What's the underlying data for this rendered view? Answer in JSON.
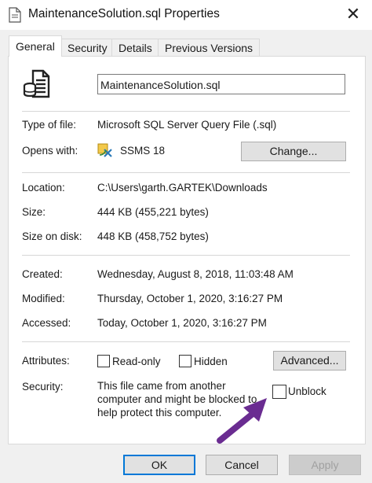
{
  "window": {
    "title": "MaintenanceSolution.sql Properties",
    "close_glyph": "✕"
  },
  "tabs": [
    "General",
    "Security",
    "Details",
    "Previous Versions"
  ],
  "general": {
    "filename": "MaintenanceSolution.sql",
    "type_label": "Type of file:",
    "type_value": "Microsoft SQL Server Query File (.sql)",
    "opens_label": "Opens with:",
    "opens_value": "SSMS 18",
    "change_button": "Change...",
    "location_label": "Location:",
    "location_value": "C:\\Users\\garth.GARTEK\\Downloads",
    "size_label": "Size:",
    "size_value": "444 KB (455,221 bytes)",
    "size_disk_label": "Size on disk:",
    "size_disk_value": "448 KB (458,752 bytes)",
    "created_label": "Created:",
    "created_value": "Wednesday, August 8, 2018, 11:03:48 AM",
    "modified_label": "Modified:",
    "modified_value": "Thursday, October 1, 2020, 3:16:27 PM",
    "accessed_label": "Accessed:",
    "accessed_value": "Today, October 1, 2020, 3:16:27 PM",
    "attributes_label": "Attributes:",
    "readonly_label": "Read-only",
    "hidden_label": "Hidden",
    "advanced_button": "Advanced...",
    "security_label": "Security:",
    "security_text": "This file came from another computer and might be blocked to help protect this computer.",
    "unblock_label": "Unblock"
  },
  "buttons": {
    "ok": "OK",
    "cancel": "Cancel",
    "apply": "Apply"
  },
  "colors": {
    "accent": "#0078d7",
    "arrow": "#6a2c91"
  },
  "icons": [
    "file-icon",
    "sql-file-icon",
    "ssms-icon",
    "close-icon",
    "arrow-annotation"
  ]
}
